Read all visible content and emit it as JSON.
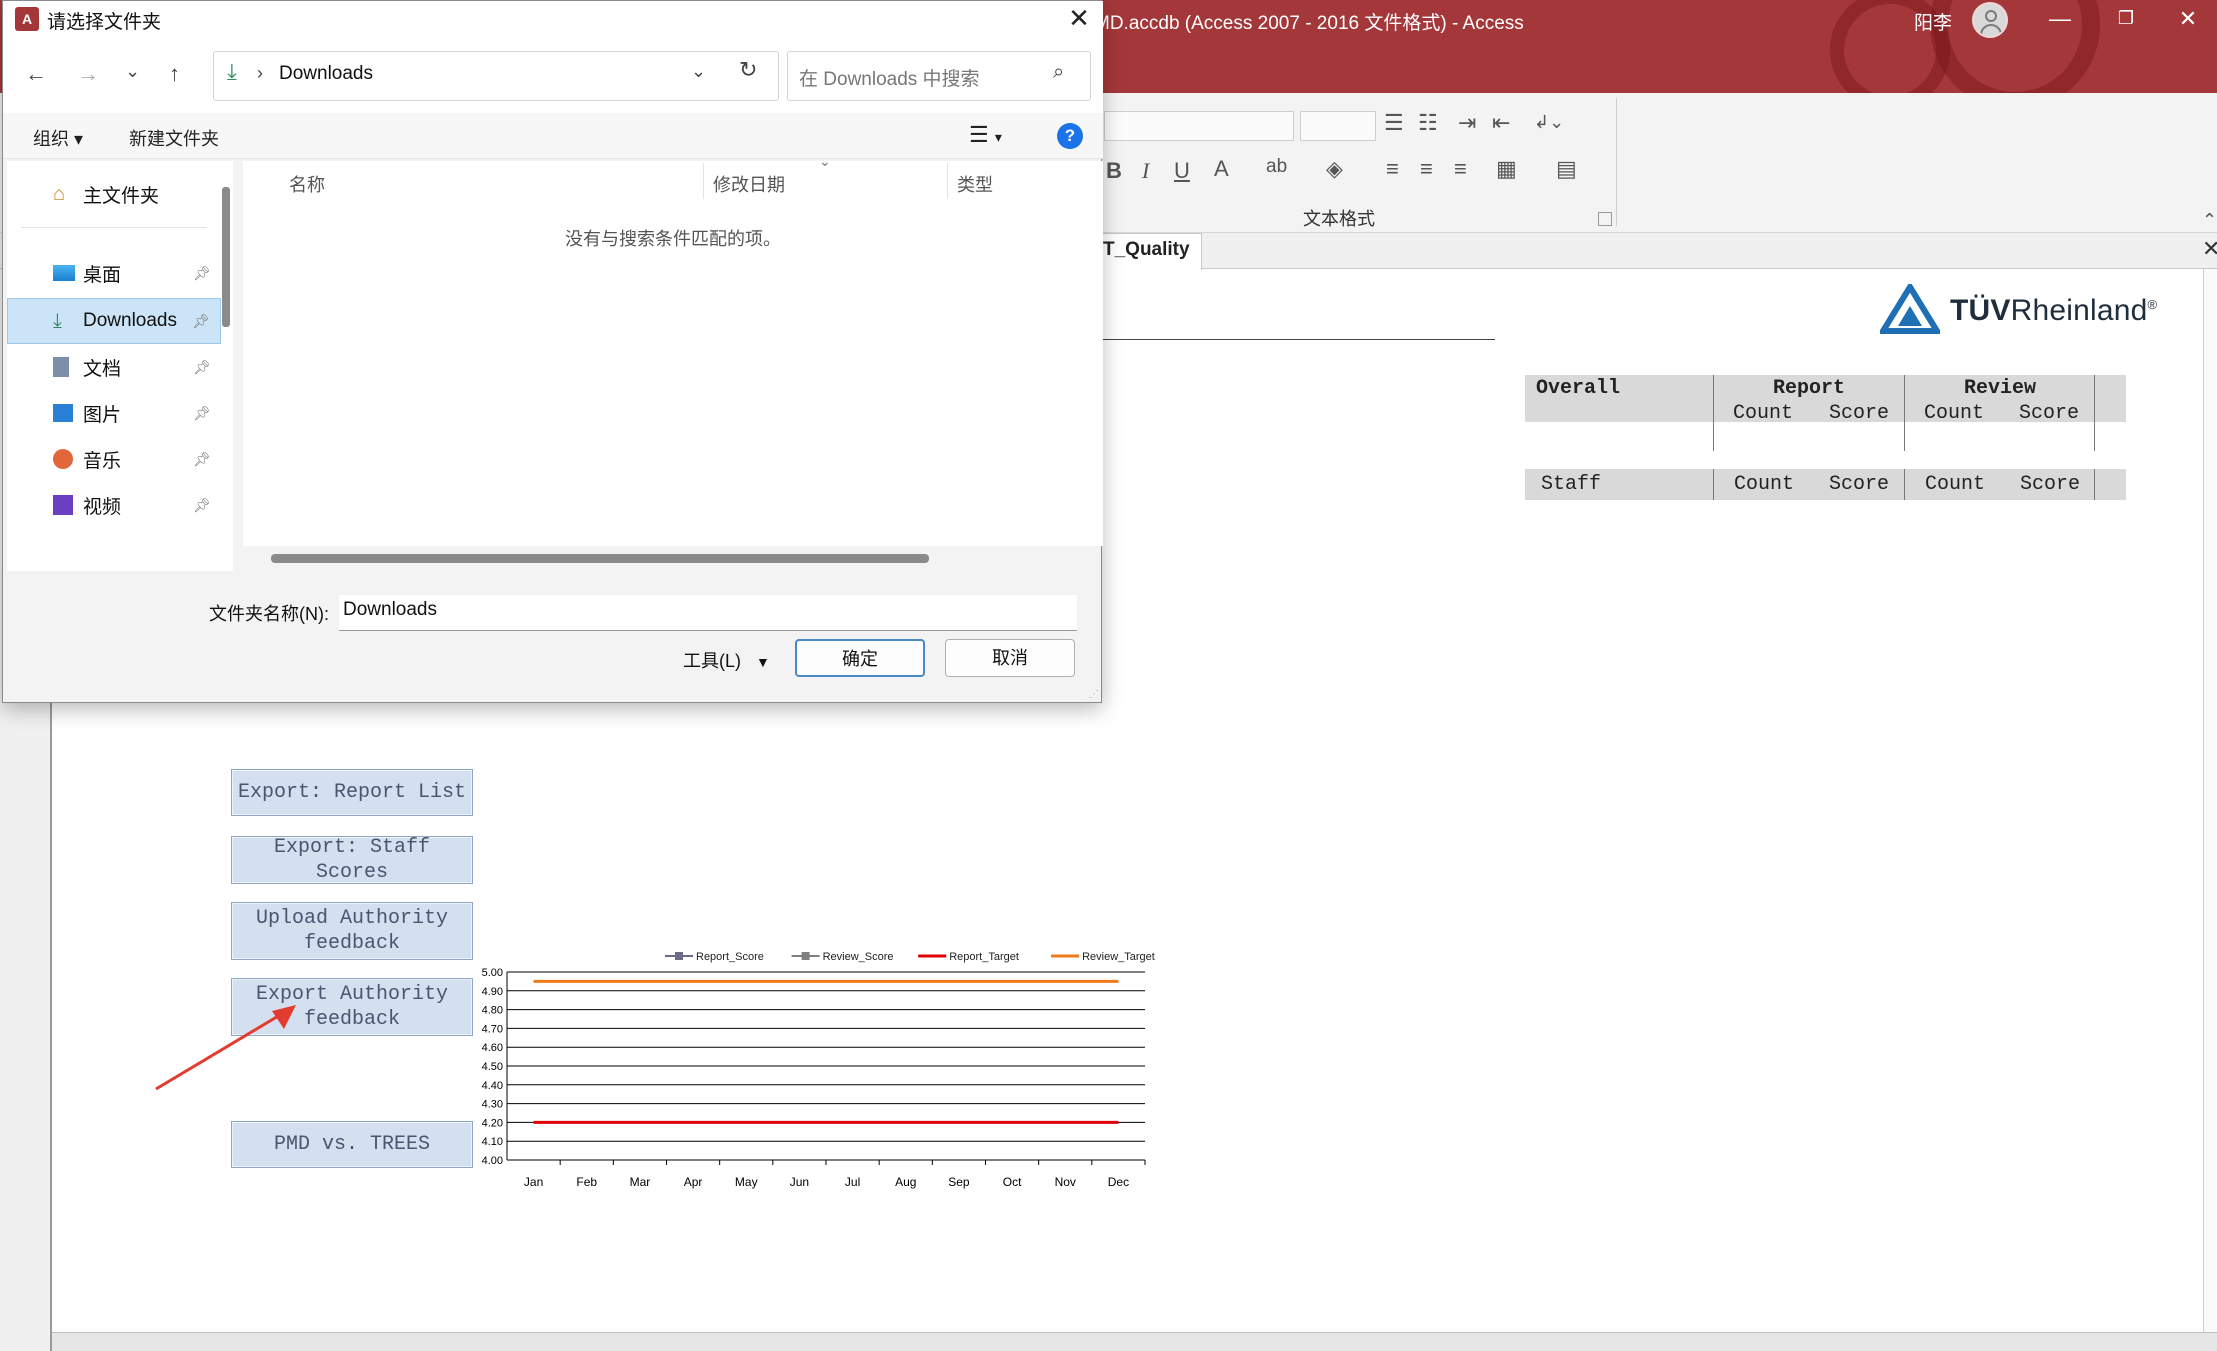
{
  "access_window": {
    "title": "MD.accdb (Access 2007 - 2016 文件格式)  -  Access",
    "user_name": "阳李",
    "ribbon_group_label": "文本格式",
    "doc_tab": "T_Quality",
    "colors": {
      "title_bar": "#a4373a",
      "form_button": "#d4dff0",
      "arrow": "#e23b2f"
    }
  },
  "report": {
    "logo_brand": "TÜV",
    "logo_brand_rest": "Rheinland",
    "logo_reg": "®",
    "overall_header": {
      "col1": "Overall",
      "report": "Report",
      "review": "Review",
      "count": "Count",
      "score": "Score"
    },
    "staff_header": {
      "col1": "Staff",
      "count": "Count",
      "score": "Score"
    }
  },
  "form_buttons": {
    "export_report_list": "Export: Report List",
    "export_staff_scores": "Export: Staff Scores",
    "upload_authority_feedback": "Upload Authority\nfeedback",
    "export_authority_feedback": "Export Authority\nfeedback",
    "pmd_vs_trees": "PMD vs. TREES"
  },
  "chart_data": {
    "type": "line",
    "categories": [
      "Jan",
      "Feb",
      "Mar",
      "Apr",
      "May",
      "Jun",
      "Jul",
      "Aug",
      "Sep",
      "Oct",
      "Nov",
      "Dec"
    ],
    "y_ticks": [
      "5.00",
      "4.90",
      "4.80",
      "4.70",
      "4.60",
      "4.50",
      "4.40",
      "4.30",
      "4.20",
      "4.10",
      "4.00"
    ],
    "ylim": [
      4.0,
      5.0
    ],
    "grid": true,
    "legend_position": "top",
    "series": [
      {
        "name": "Report_Score",
        "color": "#6b6b8a",
        "values": []
      },
      {
        "name": "Review_Score",
        "color": "#7f7f7f",
        "values": []
      },
      {
        "name": "Report_Target",
        "color": "#e00000",
        "values": [
          4.2,
          4.2,
          4.2,
          4.2,
          4.2,
          4.2,
          4.2,
          4.2,
          4.2,
          4.2,
          4.2,
          4.2
        ]
      },
      {
        "name": "Review_Target",
        "color": "#f07a1a",
        "values": [
          4.95,
          4.95,
          4.95,
          4.95,
          4.95,
          4.95,
          4.95,
          4.95,
          4.95,
          4.95,
          4.95,
          4.95
        ]
      }
    ]
  },
  "dialog": {
    "title": "请选择文件夹",
    "address": {
      "current": "Downloads",
      "search_placeholder": "在 Downloads 中搜索"
    },
    "commands": {
      "organize": "组织",
      "new_folder": "新建文件夹"
    },
    "nav_items": [
      {
        "label": "主文件夹",
        "icon": "home-icon"
      },
      {
        "label": "桌面",
        "icon": "desktop-icon"
      },
      {
        "label": "Downloads",
        "icon": "download-icon",
        "selected": true
      },
      {
        "label": "文档",
        "icon": "document-icon"
      },
      {
        "label": "图片",
        "icon": "pictures-icon"
      },
      {
        "label": "音乐",
        "icon": "music-icon"
      },
      {
        "label": "视频",
        "icon": "video-icon"
      }
    ],
    "columns": {
      "name": "名称",
      "modified": "修改日期",
      "type": "类型"
    },
    "empty_message": "没有与搜索条件匹配的项。",
    "folder_name_label": "文件夹名称(N):",
    "folder_name_value": "Downloads",
    "tools_label": "工具(L)",
    "ok_label": "确定",
    "cancel_label": "取消"
  }
}
